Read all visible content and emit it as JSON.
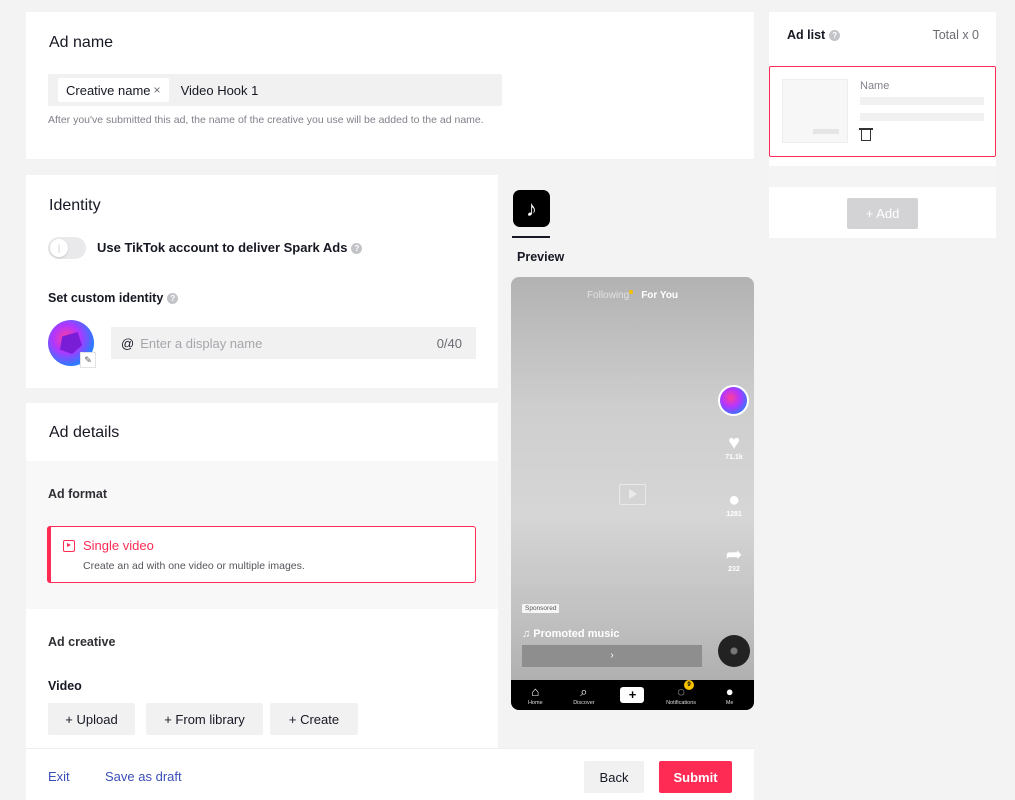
{
  "ad_name": {
    "title": "Ad name",
    "tag_label": "Creative name",
    "tag_remove": "×",
    "value": "Video Hook 1",
    "helper": "After you've submitted this ad, the name of the creative you use will be added to the ad name."
  },
  "identity": {
    "title": "Identity",
    "spark_toggle_label": "Use TikTok account to deliver Spark Ads",
    "spark_toggle_on": false,
    "custom_identity_label": "Set custom identity",
    "display_name_prefix": "@",
    "display_name_placeholder": "Enter a display name",
    "display_name_value": "",
    "display_name_count": "0/40"
  },
  "ad_details": {
    "title": "Ad details",
    "format_label": "Ad format",
    "format_option_title": "Single video",
    "format_option_desc": "Create an ad with one video or multiple images.",
    "creative_label": "Ad creative",
    "video_label": "Video",
    "upload_label": "+ Upload",
    "library_label": "+ From library",
    "create_label": "+ Create"
  },
  "preview": {
    "label": "Preview",
    "tab_following": "Following",
    "tab_for_you": "For You",
    "likes": "71.1k",
    "comments": "1281",
    "shares": "232",
    "sponsored": "Sponsored",
    "music": "♫ Promoted music",
    "cta_arrow": "›",
    "nav": [
      "Home",
      "Discover",
      "",
      "Notifications",
      "Me"
    ],
    "notification_badge": "9"
  },
  "ad_list": {
    "title": "Ad list",
    "total": "Total x 0",
    "item_name_label": "Name",
    "add_label": "+ Add"
  },
  "footer": {
    "exit": "Exit",
    "save_draft": "Save as draft",
    "back": "Back",
    "submit": "Submit"
  },
  "colors": {
    "accent": "#fe2c55",
    "link": "#3a4fb8",
    "background": "#f3f3f3"
  }
}
